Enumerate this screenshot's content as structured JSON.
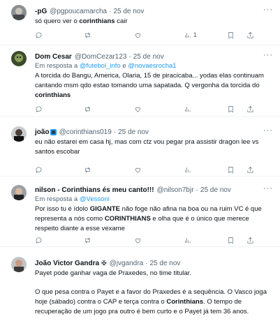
{
  "tweets": [
    {
      "name": "-pG",
      "handle": "@pgpoucamarcha",
      "date": "25 de nov",
      "text_pre": "só quero ver o ",
      "text_bold": "corinthians",
      "text_post": " cair",
      "retweets": "1"
    },
    {
      "name": "Dom Cesar",
      "handle": "@DomCezar123",
      "date": "25 de nov",
      "reply_prefix": "Em resposta a",
      "reply_to_1": "@futebol_info",
      "reply_and": "e",
      "reply_to_2": "@novaesrocha1",
      "text_pre": "A torcida do Bangu, America, Olaria, 15 de piracicaba... yodas elas continuam cantando msm qdo estao tomando uma sapatada. Q vergonha da torcida do ",
      "text_bold": "corinthians"
    },
    {
      "name": "joão",
      "handle": "@corinthians019",
      "date": "25 de nov",
      "text": "eu não estarei em casa hj, mas com ctz vou pegar pra assistir dragon lee vs santos escobar"
    },
    {
      "name": "nilson - Corinthians és meu canto!!!",
      "handle": "@nilson7bjr",
      "date": "25 de nov",
      "reply_prefix": "Em resposta a",
      "reply_to_1": "@Vessoni",
      "text_pre": "Por isso tu é ídolo ",
      "text_bold1": "GIGANTE",
      "text_mid": " não foge não afina na boa ou na ruim VC é que representa a nós como ",
      "text_bold2": "CORINTHIANS",
      "text_post": " e olha que é o único que merece respeito diante a esse vexame"
    },
    {
      "name": "João Victor Gandra",
      "handle": "@jvgandra",
      "date": "25 de nov",
      "text_line1": "Payet pode ganhar vaga de Praxedes, no time titular.",
      "text_pre": "O que pesa contra o Payet e a favor do Praxedes é a sequência. O Vasco joga hoje (sábado) contra o CAP e terça contra o ",
      "text_bold": "Corinthians",
      "text_post": ". O tempo de recuperação de um jogo pra outro é bem curto e o Payet já tem 36 anos."
    }
  ],
  "icons": {
    "more": "more-icon",
    "reply": "reply-icon",
    "retweet": "retweet-icon",
    "like": "like-icon",
    "views": "views-icon",
    "bookmark": "bookmark-icon",
    "share": "share-icon"
  },
  "colors": {
    "link": "#1d9bf0",
    "secondary": "#536471",
    "text": "#0f1419"
  }
}
